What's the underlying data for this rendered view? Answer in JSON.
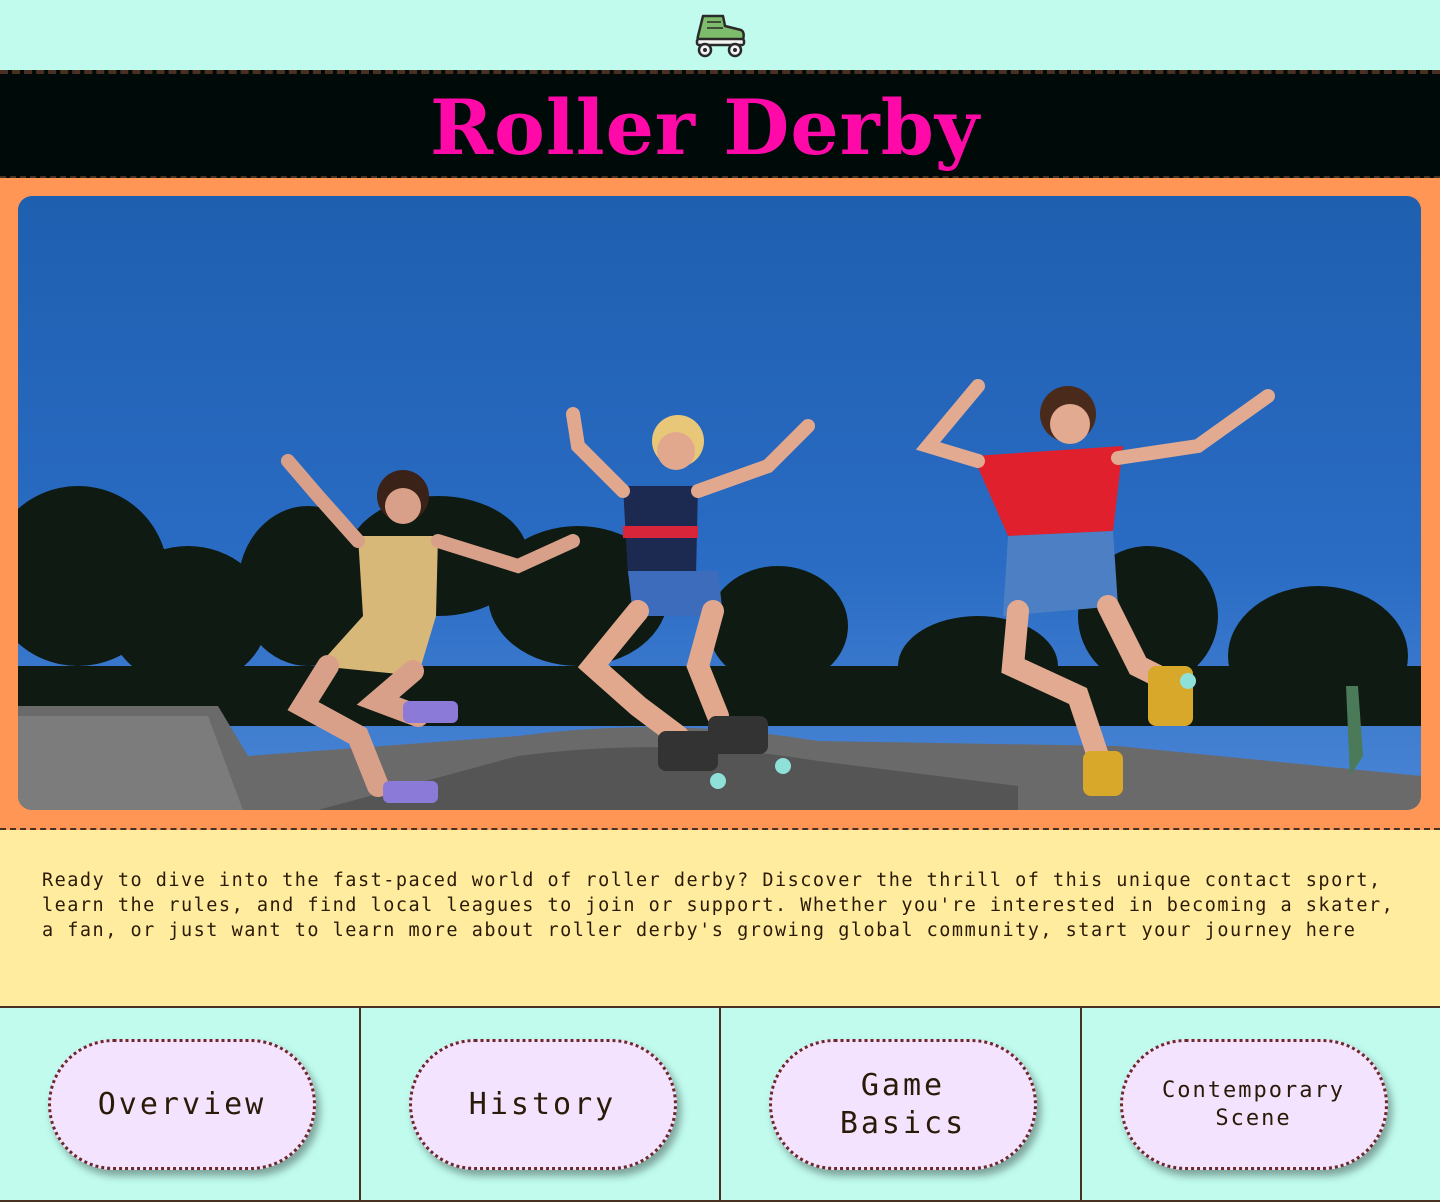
{
  "header": {
    "logo_icon": "roller-skate-icon",
    "title": "Roller Derby"
  },
  "hero": {
    "image_description": "three-roller-skaters-jumping-at-dusk"
  },
  "intro": {
    "text": "Ready to dive into the fast-paced world of roller derby? Discover the thrill of this unique contact sport, learn the rules, and find local leagues to join or support. Whether you're interested in becoming a skater, a fan, or just want to learn more about roller derby's growing global community, start your journey here"
  },
  "nav": {
    "items": [
      {
        "label": "Overview"
      },
      {
        "label": "History"
      },
      {
        "label": "Game Basics"
      },
      {
        "label": "Contemporary Scene"
      }
    ]
  },
  "colors": {
    "mint": "#c0fbee",
    "black": "#000a08",
    "title_pink": "#ff0aa8",
    "hero_orange": "#ff9655",
    "intro_yellow": "#ffec9e",
    "pill_lavender": "#f4e3ff",
    "border_brown": "#4a3020"
  }
}
